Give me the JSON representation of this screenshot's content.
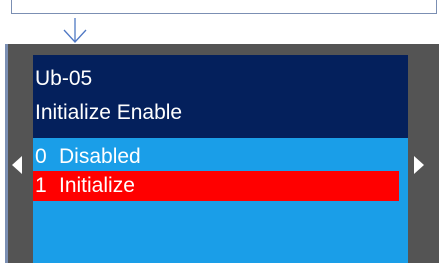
{
  "display": {
    "parameter_code": "Ub-05",
    "parameter_name": "Initialize Enable",
    "options": [
      {
        "number": "0",
        "label": "Disabled",
        "selected": false
      },
      {
        "number": "1",
        "label": "Initialize",
        "selected": true
      }
    ]
  },
  "icons": {
    "flow_arrow": "arrow-down-icon",
    "scroll_left": "triangle-left-icon",
    "scroll_right": "triangle-right-icon"
  },
  "colors": {
    "header_background": "#04205c",
    "body_background": "#1a9ee8",
    "selected_row": "#ff0000",
    "bezel": "#545454",
    "text": "#ffffff",
    "frame_line": "#7b8fb3"
  }
}
